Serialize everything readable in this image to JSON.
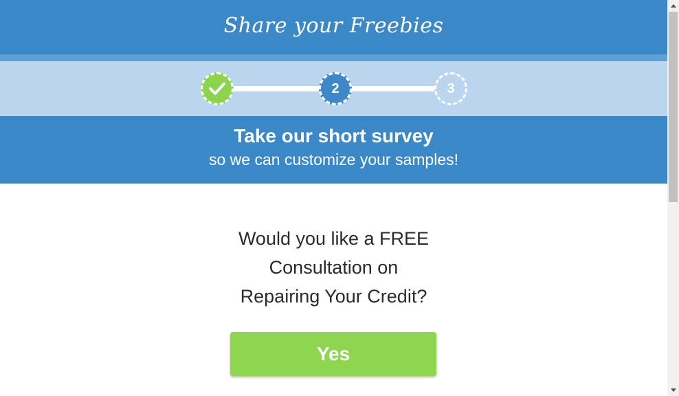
{
  "header": {
    "brand": "Share your Freebies"
  },
  "stepper": {
    "steps": [
      {
        "state": "done",
        "icon": "check-icon"
      },
      {
        "state": "current",
        "label": "2"
      },
      {
        "state": "upcoming",
        "label": "3"
      }
    ],
    "colors": {
      "done": "#8cd44d",
      "current": "#3d88c8",
      "band": "#bcd5ee"
    }
  },
  "banner": {
    "title": "Take our short survey",
    "subtitle": "so we can customize your samples!"
  },
  "question": {
    "lines": [
      "Would you like a FREE",
      "Consultation on",
      "Repairing Your Credit?"
    ]
  },
  "buttons": {
    "yes_label": "Yes",
    "yes_color": "#8ed64f"
  },
  "colors": {
    "primary": "#3b88c9"
  }
}
